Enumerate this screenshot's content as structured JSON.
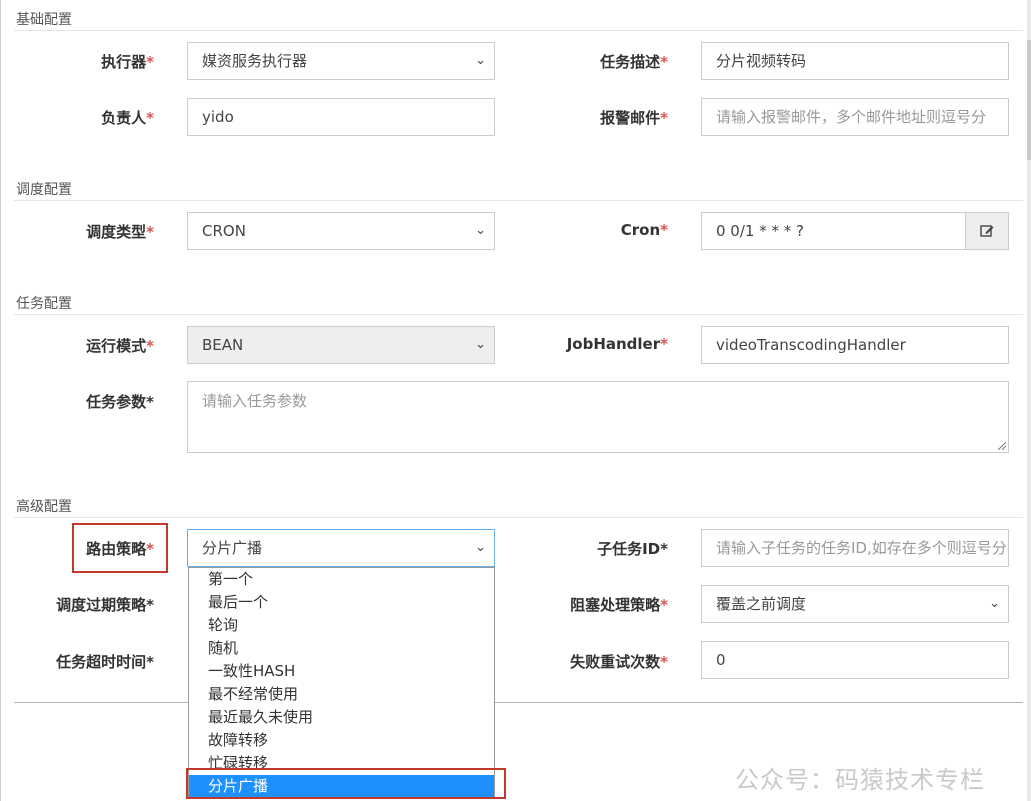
{
  "sections": {
    "basic": "基础配置",
    "schedule": "调度配置",
    "task": "任务配置",
    "advanced": "高级配置"
  },
  "form": {
    "executor": {
      "label": "执行器",
      "value": "媒资服务执行器"
    },
    "task_desc": {
      "label": "任务描述",
      "value": "分片视频转码"
    },
    "owner": {
      "label": "负责人",
      "value": "yido"
    },
    "alarm_email": {
      "label": "报警邮件",
      "placeholder": "请输入报警邮件，多个邮件地址则逗号分"
    },
    "schedule_type": {
      "label": "调度类型",
      "value": "CRON"
    },
    "cron": {
      "label": "Cron",
      "value": "0 0/1 * * * ?"
    },
    "run_mode": {
      "label": "运行模式",
      "value": "BEAN"
    },
    "job_handler": {
      "label": "JobHandler",
      "value": "videoTranscodingHandler"
    },
    "task_params": {
      "label": "任务参数",
      "placeholder": "请输入任务参数"
    },
    "route_strategy": {
      "label": "路由策略",
      "value": "分片广播"
    },
    "child_task_id": {
      "label": "子任务ID",
      "placeholder": "请输入子任务的任务ID,如存在多个则逗号分隔"
    },
    "misfire_strategy": {
      "label": "调度过期策略"
    },
    "block_strategy": {
      "label": "阻塞处理策略",
      "value": "覆盖之前调度"
    },
    "timeout": {
      "label": "任务超时时间"
    },
    "retry_count": {
      "label": "失败重试次数",
      "value": "0"
    }
  },
  "required_mark": "*",
  "route_options": [
    "第一个",
    "最后一个",
    "轮询",
    "随机",
    "一致性HASH",
    "最不经常使用",
    "最近最久未使用",
    "故障转移",
    "忙碌转移",
    "分片广播"
  ],
  "route_selected_index": 9,
  "watermark": "公众号：码猿技术专栏",
  "icons": {
    "chevron": "chevron-down-icon",
    "edit": "edit-icon"
  }
}
